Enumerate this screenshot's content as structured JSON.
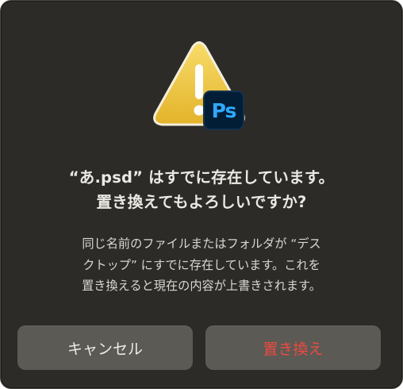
{
  "dialog": {
    "title_line1": "“あ.psd” はすでに存在しています。",
    "title_line2": "置き換えてもよろしいですか?",
    "message_line1": "同じ名前のファイルまたはフォルダが “デス",
    "message_line2": "クトップ” にすでに存在しています。これを",
    "message_line3": "置き換えると現在の内容が上書きされます。",
    "app_badge": "Ps",
    "icons": {
      "warning": "warning-triangle-icon",
      "app": "photoshop-app-icon"
    },
    "buttons": {
      "cancel_label": "キャンセル",
      "replace_label": "置き換え"
    },
    "colors": {
      "background": "#2c2b27",
      "button": "#5b5a55",
      "destructive_text": "#ee4a3f",
      "warning_yellow": "#f2c94c",
      "ps_blue": "#31a8ff",
      "ps_navy": "#011e36"
    }
  }
}
